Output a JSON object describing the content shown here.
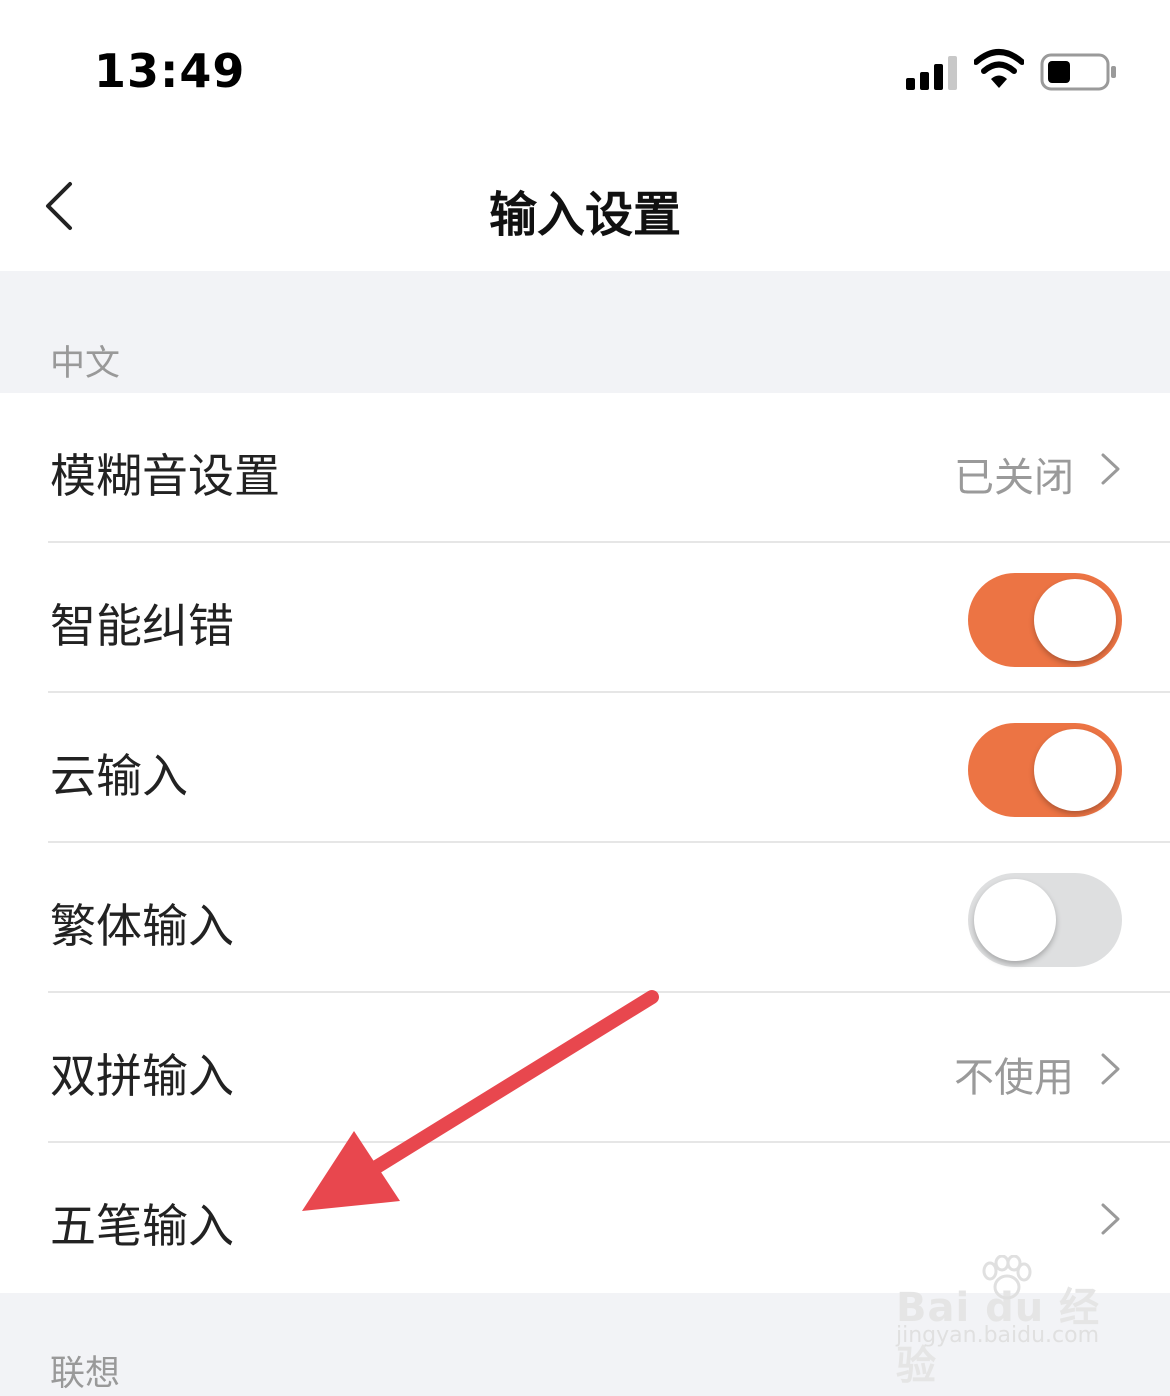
{
  "status": {
    "time": "13:49"
  },
  "nav": {
    "title": "输入设置"
  },
  "sections": [
    {
      "label": "中文"
    },
    {
      "label": "联想"
    }
  ],
  "rows": [
    {
      "label": "模糊音设置",
      "value": "已关闭",
      "control": "chevron"
    },
    {
      "label": "智能纠错",
      "control": "toggle",
      "on": true
    },
    {
      "label": "云输入",
      "control": "toggle",
      "on": true
    },
    {
      "label": "繁体输入",
      "control": "toggle",
      "on": false
    },
    {
      "label": "双拼输入",
      "value": "不使用",
      "control": "chevron"
    },
    {
      "label": "五笔输入",
      "control": "chevron"
    }
  ],
  "colors": {
    "accent": "#ec7444",
    "toggle_off": "#dedfe0",
    "annotation_arrow": "#e8474e"
  },
  "watermark": {
    "logo": "Bai du 经验",
    "url": "jingyan.baidu.com"
  }
}
